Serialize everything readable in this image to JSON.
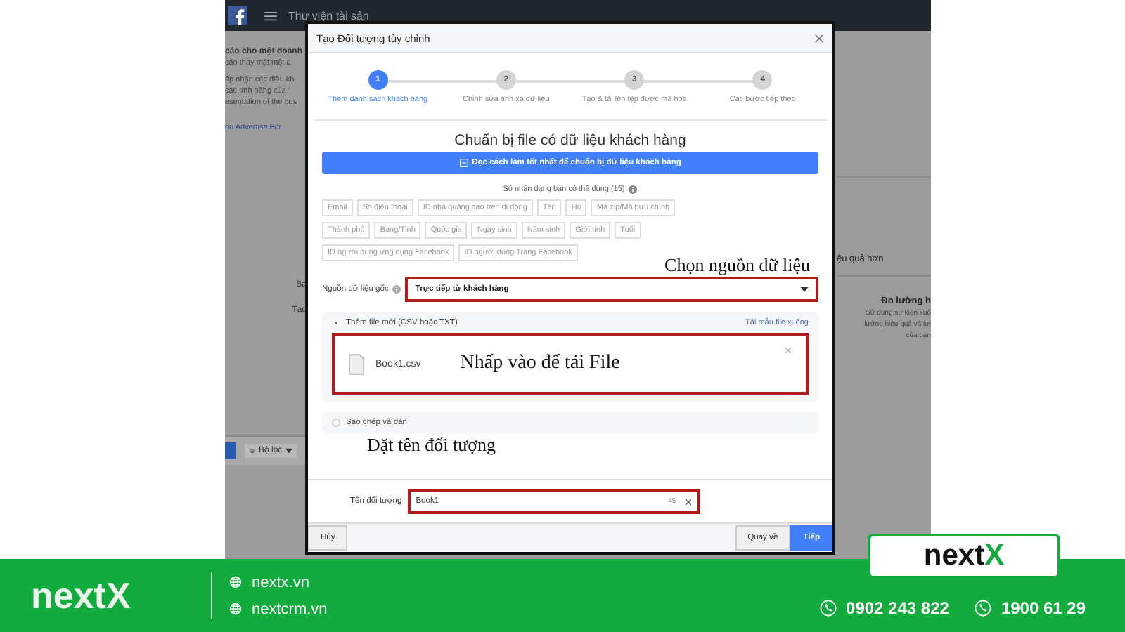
{
  "background_page": {
    "top_bar_title": "Thư viện tài sản",
    "left_heading": "cáo cho một doanh",
    "left_texts": [
      "cáo thay mặt một d",
      "ấp nhận các điều kh",
      "các tính năng của '",
      "esentation of the bus"
    ],
    "left_link": "ou Advertise For",
    "left_lower_texts": [
      "Ba",
      "Tạo"
    ],
    "filter_button": "Bộ lọc",
    "right_heading": "ệu quả hơn",
    "right_card_title": "Đo lường h",
    "right_card_texts": [
      "Sử dụng sự kiện xuố",
      "lường hiệu quả và lợi",
      "của bạn"
    ]
  },
  "dialog": {
    "title": "Tạo Đối tượng tùy chỉnh",
    "steps": [
      {
        "number": "1",
        "label": "Thêm danh sách khách hàng",
        "active": true
      },
      {
        "number": "2",
        "label": "Chỉnh sửa ánh xạ dữ liệu",
        "active": false
      },
      {
        "number": "3",
        "label": "Tạo & tải lên tệp được mã hóa",
        "active": false
      },
      {
        "number": "4",
        "label": "Các bước tiếp theo",
        "active": false
      }
    ],
    "heading": "Chuẩn bị file có dữ liệu khách hàng",
    "guide_button": "Đọc cách làm tốt nhất để chuẩn bị dữ liệu khách hàng",
    "identifiers_label": "Số nhận dạng bạn có thể dùng (15)",
    "identifier_rows": [
      [
        "Email",
        "Số điện thoại",
        "ID nhà quảng cáo trên di động",
        "Tên",
        "Họ",
        "Mã zip/Mã bưu chính"
      ],
      [
        "Thành phố",
        "Bang/Tỉnh",
        "Quốc gia",
        "Ngày sinh",
        "Năm sinh",
        "Giới tính",
        "Tuổi"
      ],
      [
        "ID người dùng ứng dụng Facebook",
        "ID người dùng Trang Facebook"
      ]
    ],
    "source_annotation": "Chọn nguồn dữ liệu",
    "source_label": "Nguồn dữ liệu gốc",
    "source_value": "Trực tiếp từ khách hàng",
    "upload_options": [
      {
        "label": "Thêm file mới (CSV hoặc TXT)",
        "selected": true,
        "link": "Tải mẫu file xuống",
        "file_name": "Book1.csv",
        "annotation": "Nhấp vào để tải File"
      },
      {
        "label": "Sao chép và dán",
        "selected": false
      }
    ],
    "name_annotation": "Đặt tên đối tượng",
    "name_label": "Tên đối tượng",
    "name_value": "Book1",
    "name_counter": "45",
    "cancel_button": "Hủy",
    "back_button": "Quay về",
    "next_button": "Tiếp"
  },
  "brand_badge": {
    "text": "next",
    "accent": "X"
  },
  "footer": {
    "logo": "nextX",
    "websites": [
      "nextx.vn",
      "nextcrm.vn"
    ],
    "phones": [
      "0902 243 822",
      "1900 61 29"
    ]
  }
}
